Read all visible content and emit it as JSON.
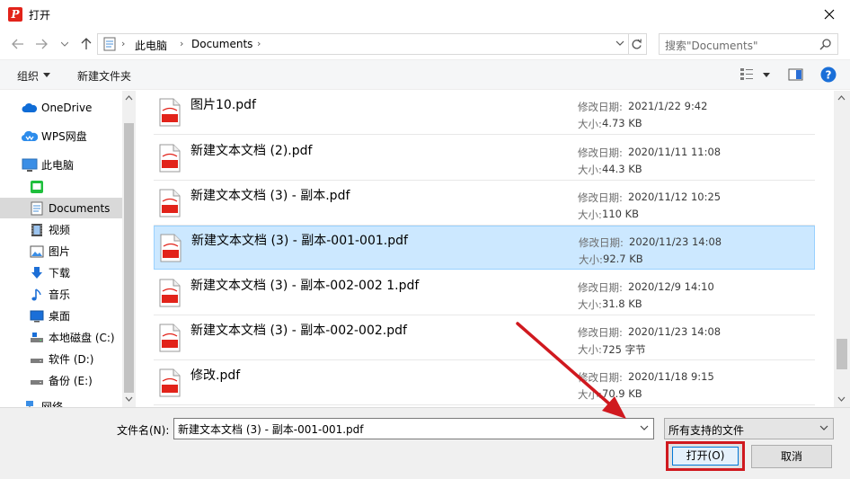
{
  "window": {
    "title": "打开",
    "app_icon_letter": "P"
  },
  "address": {
    "crumbs": [
      "此电脑",
      "Documents"
    ]
  },
  "search": {
    "placeholder": "搜索\"Documents\""
  },
  "toolbar": {
    "organize_label": "组织",
    "new_folder_label": "新建文件夹"
  },
  "nav": {
    "items": [
      {
        "label": "OneDrive",
        "icon": "cloud-icon"
      },
      {
        "label": "WPS网盘",
        "icon": "wps-cloud-icon"
      },
      {
        "label": "此电脑",
        "icon": "computer-icon"
      },
      {
        "label": "",
        "icon": "green-app-icon"
      },
      {
        "label": "Documents",
        "icon": "documents-icon",
        "selected": true
      },
      {
        "label": "视频",
        "icon": "video-icon"
      },
      {
        "label": "图片",
        "icon": "picture-icon"
      },
      {
        "label": "下载",
        "icon": "download-icon"
      },
      {
        "label": "音乐",
        "icon": "music-icon"
      },
      {
        "label": "桌面",
        "icon": "desktop-icon"
      },
      {
        "label": "本地磁盘 (C:)",
        "icon": "drive-icon"
      },
      {
        "label": "软件 (D:)",
        "icon": "drive-icon"
      },
      {
        "label": "备份 (E:)",
        "icon": "drive-icon"
      },
      {
        "label": "网络",
        "icon": "network-icon"
      }
    ]
  },
  "files": {
    "date_label": "修改日期:",
    "size_label": "大小:",
    "items": [
      {
        "name": "图片10.pdf",
        "date": "2021/1/22 9:42",
        "size": "4.73 KB"
      },
      {
        "name": "新建文本文档 (2).pdf",
        "date": "2020/11/11 11:08",
        "size": "44.3 KB"
      },
      {
        "name": "新建文本文档 (3) - 副本.pdf",
        "date": "2020/11/12 10:25",
        "size": "110 KB"
      },
      {
        "name": "新建文本文档 (3) - 副本-001-001.pdf",
        "date": "2020/11/23 14:08",
        "size": "92.7 KB",
        "selected": true
      },
      {
        "name": "新建文本文档 (3) - 副本-002-002 1.pdf",
        "date": "2020/12/9 14:10",
        "size": "31.8 KB"
      },
      {
        "name": "新建文本文档 (3) - 副本-002-002.pdf",
        "date": "2020/11/23 14:08",
        "size": "725 字节"
      },
      {
        "name": "修改.pdf",
        "date": "2020/11/18 9:15",
        "size": "70.9 KB"
      }
    ]
  },
  "bottom": {
    "filename_label": "文件名(N):",
    "filename_value": "新建文本文档 (3) - 副本-001-001.pdf",
    "filetype_value": "所有支持的文件",
    "open_label": "打开(O)",
    "cancel_label": "取消"
  },
  "colors": {
    "selection": "#cce8ff",
    "highlight_box": "#d0191f",
    "pdf_red": "#e2231a",
    "annotation_arrow": "#d0191f"
  }
}
